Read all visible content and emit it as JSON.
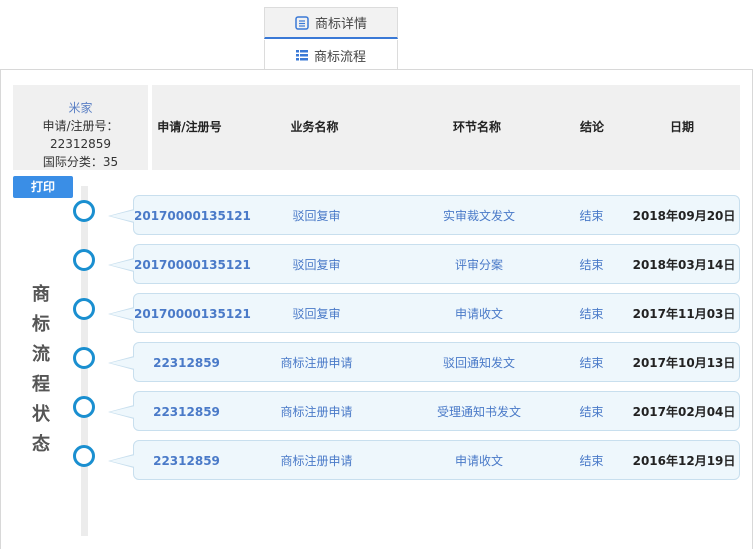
{
  "tabs": {
    "detail_label": "商标详情",
    "flow_label": "商标流程"
  },
  "info": {
    "owner": "米家",
    "reg_label": "申请/注册号：22312859",
    "class_label": "国际分类：35"
  },
  "headers": {
    "reg_no": "申请/注册号",
    "business": "业务名称",
    "step": "环节名称",
    "result": "结论",
    "date": "日期"
  },
  "print_label": "打印",
  "vertical_title": [
    "商",
    "标",
    "流",
    "程",
    "状",
    "态"
  ],
  "rows": [
    {
      "reg_no": "20170000135121",
      "business": "驳回复审",
      "step": "实审裁文发文",
      "result": "结束",
      "date": "2018年09月20日"
    },
    {
      "reg_no": "20170000135121",
      "business": "驳回复审",
      "step": "评审分案",
      "result": "结束",
      "date": "2018年03月14日"
    },
    {
      "reg_no": "20170000135121",
      "business": "驳回复审",
      "step": "申请收文",
      "result": "结束",
      "date": "2017年11月03日"
    },
    {
      "reg_no": "22312859",
      "business": "商标注册申请",
      "step": "驳回通知发文",
      "result": "结束",
      "date": "2017年10月13日"
    },
    {
      "reg_no": "22312859",
      "business": "商标注册申请",
      "step": "受理通知书发文",
      "result": "结束",
      "date": "2017年02月04日"
    },
    {
      "reg_no": "22312859",
      "business": "商标注册申请",
      "step": "申请收文",
      "result": "结束",
      "date": "2016年12月19日"
    }
  ],
  "colors": {
    "accent": "#3a8ee6",
    "node": "#1a8fd0",
    "card_bg": "#eef7fc",
    "link": "#4a7ac8"
  }
}
